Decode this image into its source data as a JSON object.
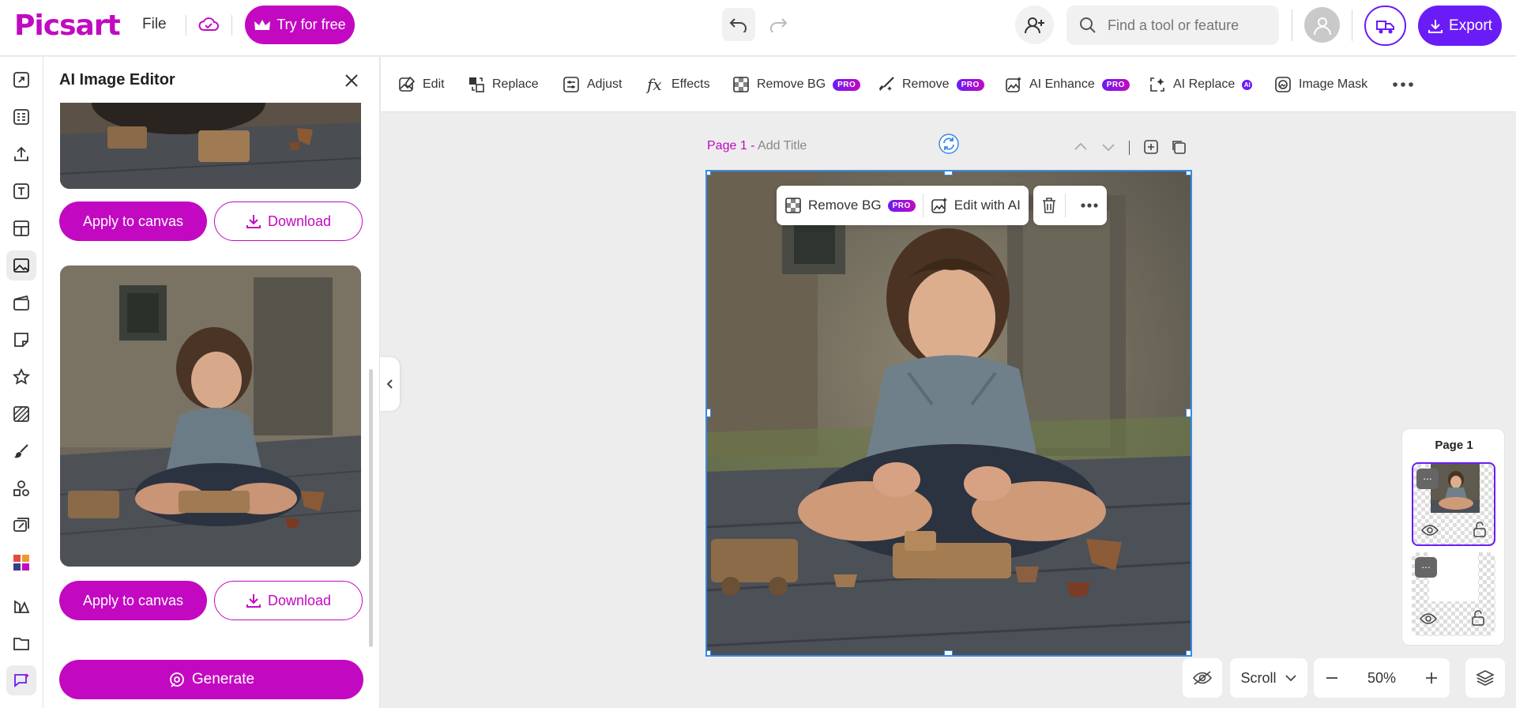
{
  "header": {
    "logo": "Picsart",
    "file_menu": "File",
    "try_button": "Try for free",
    "search_placeholder": "Find a tool or feature",
    "export_button": "Export"
  },
  "panel": {
    "title": "AI Image Editor",
    "results": [
      {
        "apply_label": "Apply to canvas",
        "download_label": "Download"
      },
      {
        "apply_label": "Apply to canvas",
        "download_label": "Download"
      }
    ],
    "generate_button": "Generate"
  },
  "tools": [
    {
      "label": "Edit",
      "icon": "edit-icon"
    },
    {
      "label": "Replace",
      "icon": "replace-icon"
    },
    {
      "label": "Adjust",
      "icon": "adjust-icon"
    },
    {
      "label": "Effects",
      "icon": "fx-icon"
    },
    {
      "label": "Remove BG",
      "icon": "remove-bg-icon",
      "badge": "PRO"
    },
    {
      "label": "Remove",
      "icon": "remove-icon",
      "badge": "PRO"
    },
    {
      "label": "AI Enhance",
      "icon": "ai-enhance-icon",
      "badge": "PRO"
    },
    {
      "label": "AI Replace",
      "icon": "ai-replace-icon",
      "badge": "AI"
    },
    {
      "label": "Image Mask",
      "icon": "image-mask-icon"
    }
  ],
  "canvas": {
    "page_number": "Page 1 -",
    "page_title_placeholder": "Add Title",
    "context": {
      "remove_bg": "Remove BG",
      "pro_badge": "PRO",
      "edit_ai": "Edit with AI"
    }
  },
  "layers": {
    "title": "Page 1"
  },
  "bottom": {
    "scroll_mode": "Scroll",
    "zoom": "50%"
  },
  "colors": {
    "brand": "#c209c1",
    "accent": "#6a1cf6",
    "selection": "#3a8be6"
  }
}
